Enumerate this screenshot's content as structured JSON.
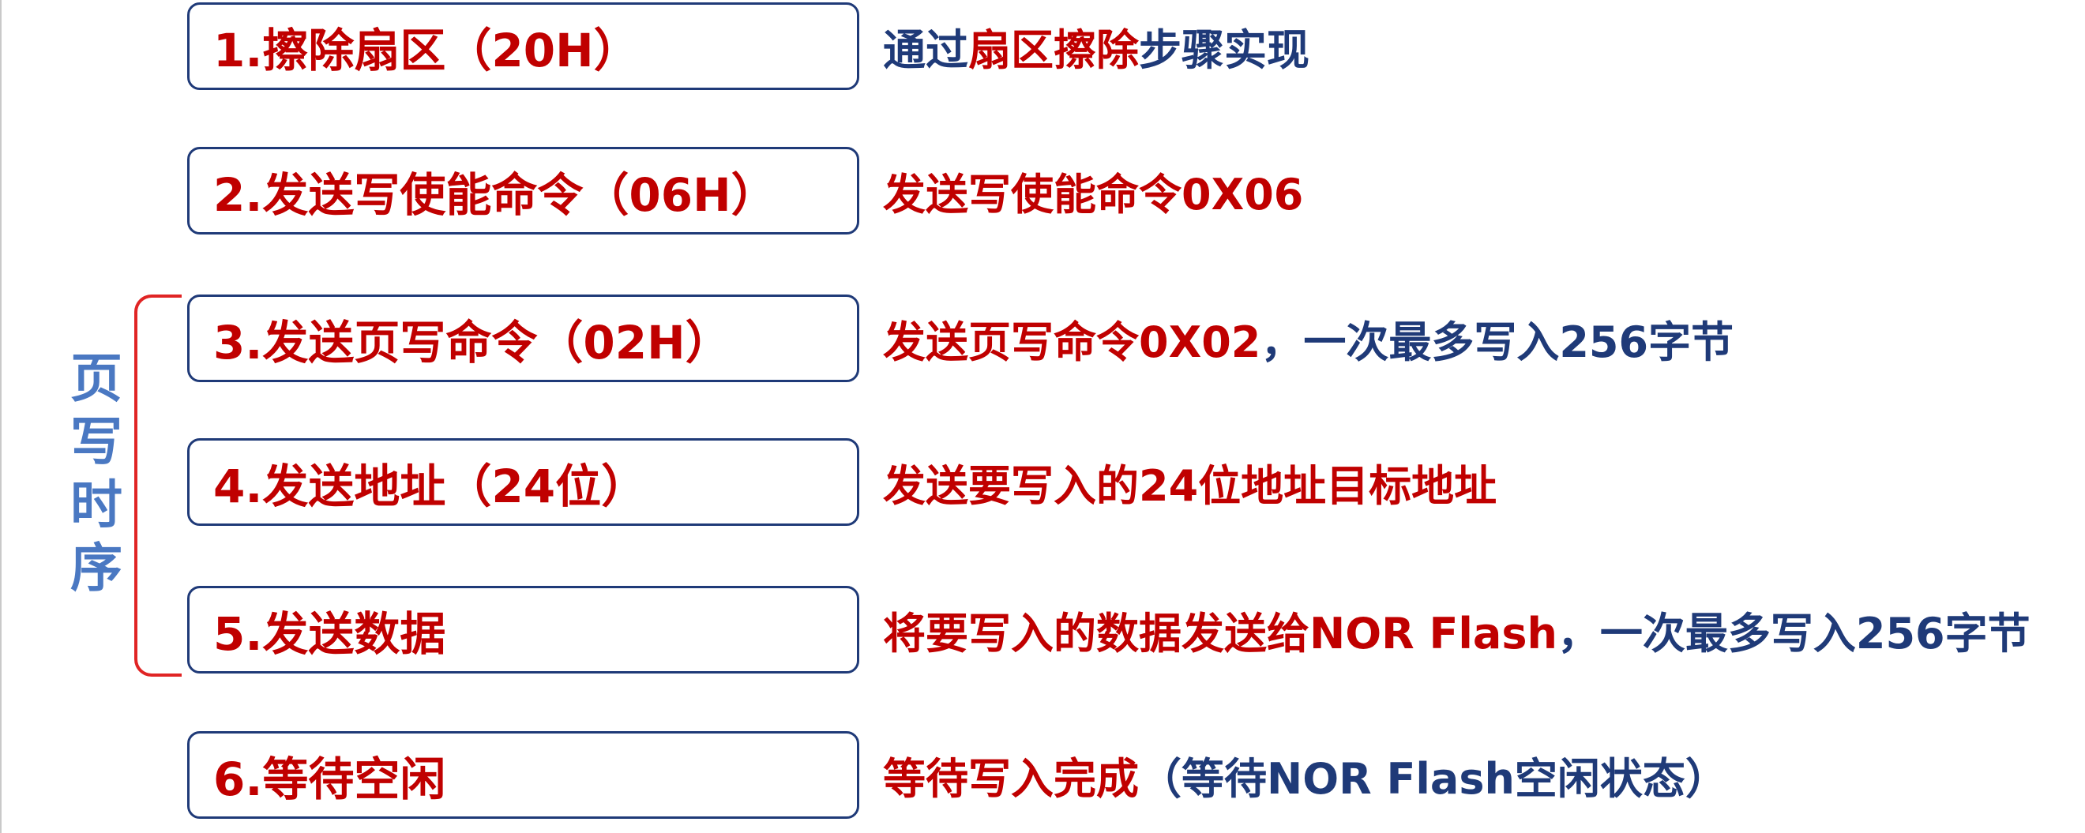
{
  "steps": [
    {
      "label": "1.擦除扇区（20H）",
      "desc": [
        {
          "t": "通过",
          "c": "b"
        },
        {
          "t": "扇区擦除",
          "c": "r"
        },
        {
          "t": "步骤实现",
          "c": "b"
        }
      ]
    },
    {
      "label": "2.发送写使能命令（06H）",
      "desc": [
        {
          "t": "发送写使能命令0X06",
          "c": "r"
        }
      ]
    },
    {
      "label": "3.发送页写命令（02H）",
      "desc": [
        {
          "t": "发送页写命令0X02",
          "c": "r"
        },
        {
          "t": "，一次最多写入256字节",
          "c": "b"
        }
      ]
    },
    {
      "label": "4.发送地址（24位）",
      "desc": [
        {
          "t": "发送要写入的24位地址目标地址",
          "c": "r"
        }
      ]
    },
    {
      "label": "5.发送数据",
      "desc": [
        {
          "t": "将要写入的数据发送给NOR Flash",
          "c": "r"
        },
        {
          "t": "，一次最多写入256字节",
          "c": "b"
        }
      ]
    },
    {
      "label": "6.等待空闲",
      "desc": [
        {
          "t": "等待写入完成",
          "c": "r"
        },
        {
          "t": "（等待NOR Flash空闲状态）",
          "c": "b"
        }
      ]
    }
  ],
  "group_label": {
    "chars": [
      "页",
      "写",
      "时",
      "序"
    ]
  },
  "colors": {
    "red": "#c00000",
    "navy": "#1f3a78",
    "bracket": "#e02424",
    "group_label": "#4a78c2"
  }
}
